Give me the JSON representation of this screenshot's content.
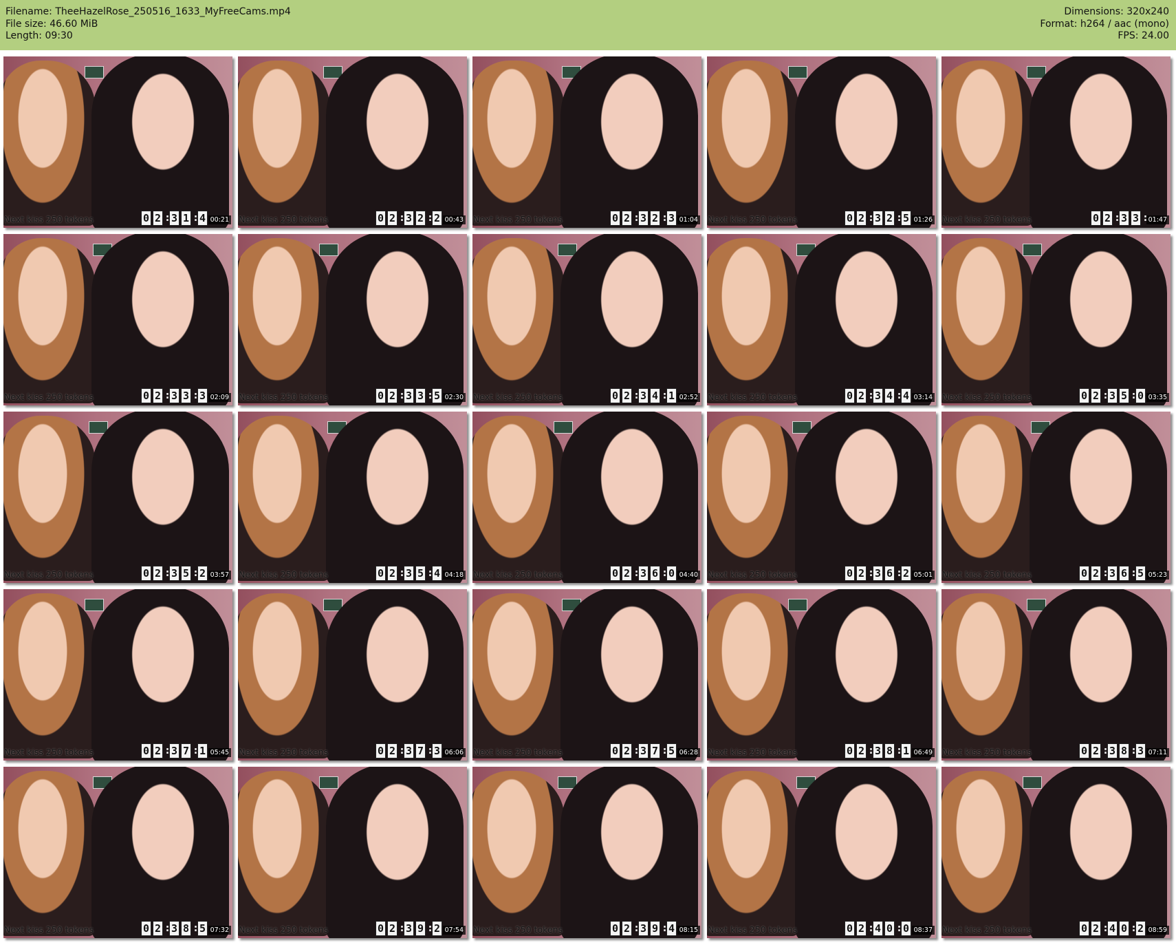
{
  "header": {
    "filename_label": "Filename:",
    "filename": "TheeHazelRose_250516_1633_MyFreeCams.mp4",
    "filesize_label": "File size:",
    "filesize": "46.60 MiB",
    "length_label": "Length:",
    "length": "09:30",
    "dimensions_label": "Dimensions:",
    "dimensions": "320x240",
    "format_label": "Format:",
    "format": "h264 / aac (mono)",
    "fps_label": "FPS:",
    "fps": "24.00"
  },
  "thumbnails": [
    {
      "caption": "Next kiss 250 tokens",
      "clock": "02:31:4",
      "stamp": "00:21"
    },
    {
      "caption": "Next kiss 250 tokens",
      "clock": "02:32:2",
      "stamp": "00:43"
    },
    {
      "caption": "Next kiss 250 tokens",
      "clock": "02:32:3",
      "stamp": "01:04"
    },
    {
      "caption": "Next kiss 250 tokens",
      "clock": "02:32:5",
      "stamp": "01:26"
    },
    {
      "caption": "Next kiss 250 tokens",
      "clock": "02:33:",
      "stamp": "01:47"
    },
    {
      "caption": "Next kiss 250 tokens",
      "clock": "02:33:3",
      "stamp": "02:09"
    },
    {
      "caption": "Next kiss 250 tokens",
      "clock": "02:33:5",
      "stamp": "02:30"
    },
    {
      "caption": "Next kiss 250 tokens",
      "clock": "02:34:1",
      "stamp": "02:52"
    },
    {
      "caption": "Next kiss 250 tokens",
      "clock": "02:34:4",
      "stamp": "03:14"
    },
    {
      "caption": "Next kiss 250 tokens",
      "clock": "02:35:0",
      "stamp": "03:35"
    },
    {
      "caption": "Next kiss 250 tokens",
      "clock": "02:35:2",
      "stamp": "03:57"
    },
    {
      "caption": "Next kiss 250 tokens",
      "clock": "02:35:4",
      "stamp": "04:18"
    },
    {
      "caption": "Next kiss 250 tokens",
      "clock": "02:36:0",
      "stamp": "04:40"
    },
    {
      "caption": "Next kiss 250 tokens",
      "clock": "02:36:2",
      "stamp": "05:01"
    },
    {
      "caption": "Next kiss 250 tokens",
      "clock": "02:36:5",
      "stamp": "05:23"
    },
    {
      "caption": "Next kiss 250 tokens",
      "clock": "02:37:1",
      "stamp": "05:45"
    },
    {
      "caption": "Next kiss 250 tokens",
      "clock": "02:37:3",
      "stamp": "06:06"
    },
    {
      "caption": "Next kiss 250 tokens",
      "clock": "02:37:5",
      "stamp": "06:28"
    },
    {
      "caption": "Next kiss 250 tokens",
      "clock": "02:38:1",
      "stamp": "06:49"
    },
    {
      "caption": "Next kiss 250 tokens",
      "clock": "02:38:3",
      "stamp": "07:11"
    },
    {
      "caption": "Next kiss 250 tokens",
      "clock": "02:38:5",
      "stamp": "07:32"
    },
    {
      "caption": "Next kiss 250 tokens",
      "clock": "02:39:2",
      "stamp": "07:54"
    },
    {
      "caption": "Next kiss 250 tokens",
      "clock": "02:39:4",
      "stamp": "08:15"
    },
    {
      "caption": "Next kiss 250 tokens",
      "clock": "02:40:0",
      "stamp": "08:37"
    },
    {
      "caption": "Next kiss 250 tokens",
      "clock": "02:40:2",
      "stamp": "08:59"
    }
  ]
}
